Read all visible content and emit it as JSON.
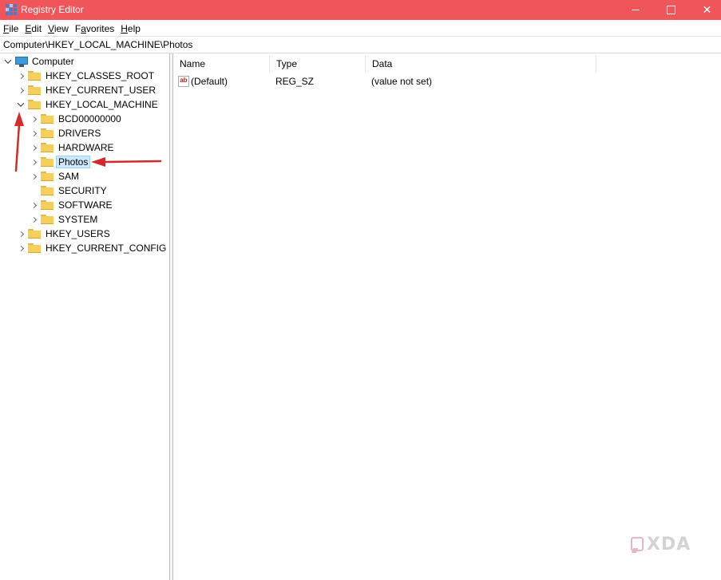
{
  "window": {
    "title": "Registry Editor",
    "controls": {
      "minimize": "minimize",
      "maximize": "maximize",
      "close": "✕"
    }
  },
  "menu": {
    "items": [
      {
        "ul": "F",
        "rest": "ile"
      },
      {
        "ul": "E",
        "rest": "dit"
      },
      {
        "ul": "V",
        "rest": "iew"
      },
      {
        "ul": "",
        "pre": "F",
        "ul2": "a",
        "rest": "vorites"
      },
      {
        "ul": "H",
        "rest": "elp"
      }
    ]
  },
  "address": {
    "path": "Computer\\HKEY_LOCAL_MACHINE\\Photos"
  },
  "tree": {
    "root": "Computer",
    "hives": [
      {
        "label": "HKEY_CLASSES_ROOT"
      },
      {
        "label": "HKEY_CURRENT_USER"
      },
      {
        "label": "HKEY_LOCAL_MACHINE"
      },
      {
        "label": "HKEY_USERS"
      },
      {
        "label": "HKEY_CURRENT_CONFIG"
      }
    ],
    "hklm_children": [
      {
        "label": "BCD00000000"
      },
      {
        "label": "DRIVERS"
      },
      {
        "label": "HARDWARE"
      },
      {
        "label": "Photos"
      },
      {
        "label": "SAM"
      },
      {
        "label": "SECURITY"
      },
      {
        "label": "SOFTWARE"
      },
      {
        "label": "SYSTEM"
      }
    ],
    "selected": "Photos"
  },
  "values_list": {
    "columns": {
      "name": "Name",
      "type": "Type",
      "data": "Data"
    },
    "rows": [
      {
        "icon": "ab",
        "name": "(Default)",
        "type": "REG_SZ",
        "data": "(value not set)"
      }
    ]
  },
  "watermark": {
    "text": "XDA"
  },
  "colors": {
    "titlebar": "#f0555a",
    "selection": "#cce8ff",
    "annotation_arrow": "#d42a2a"
  }
}
